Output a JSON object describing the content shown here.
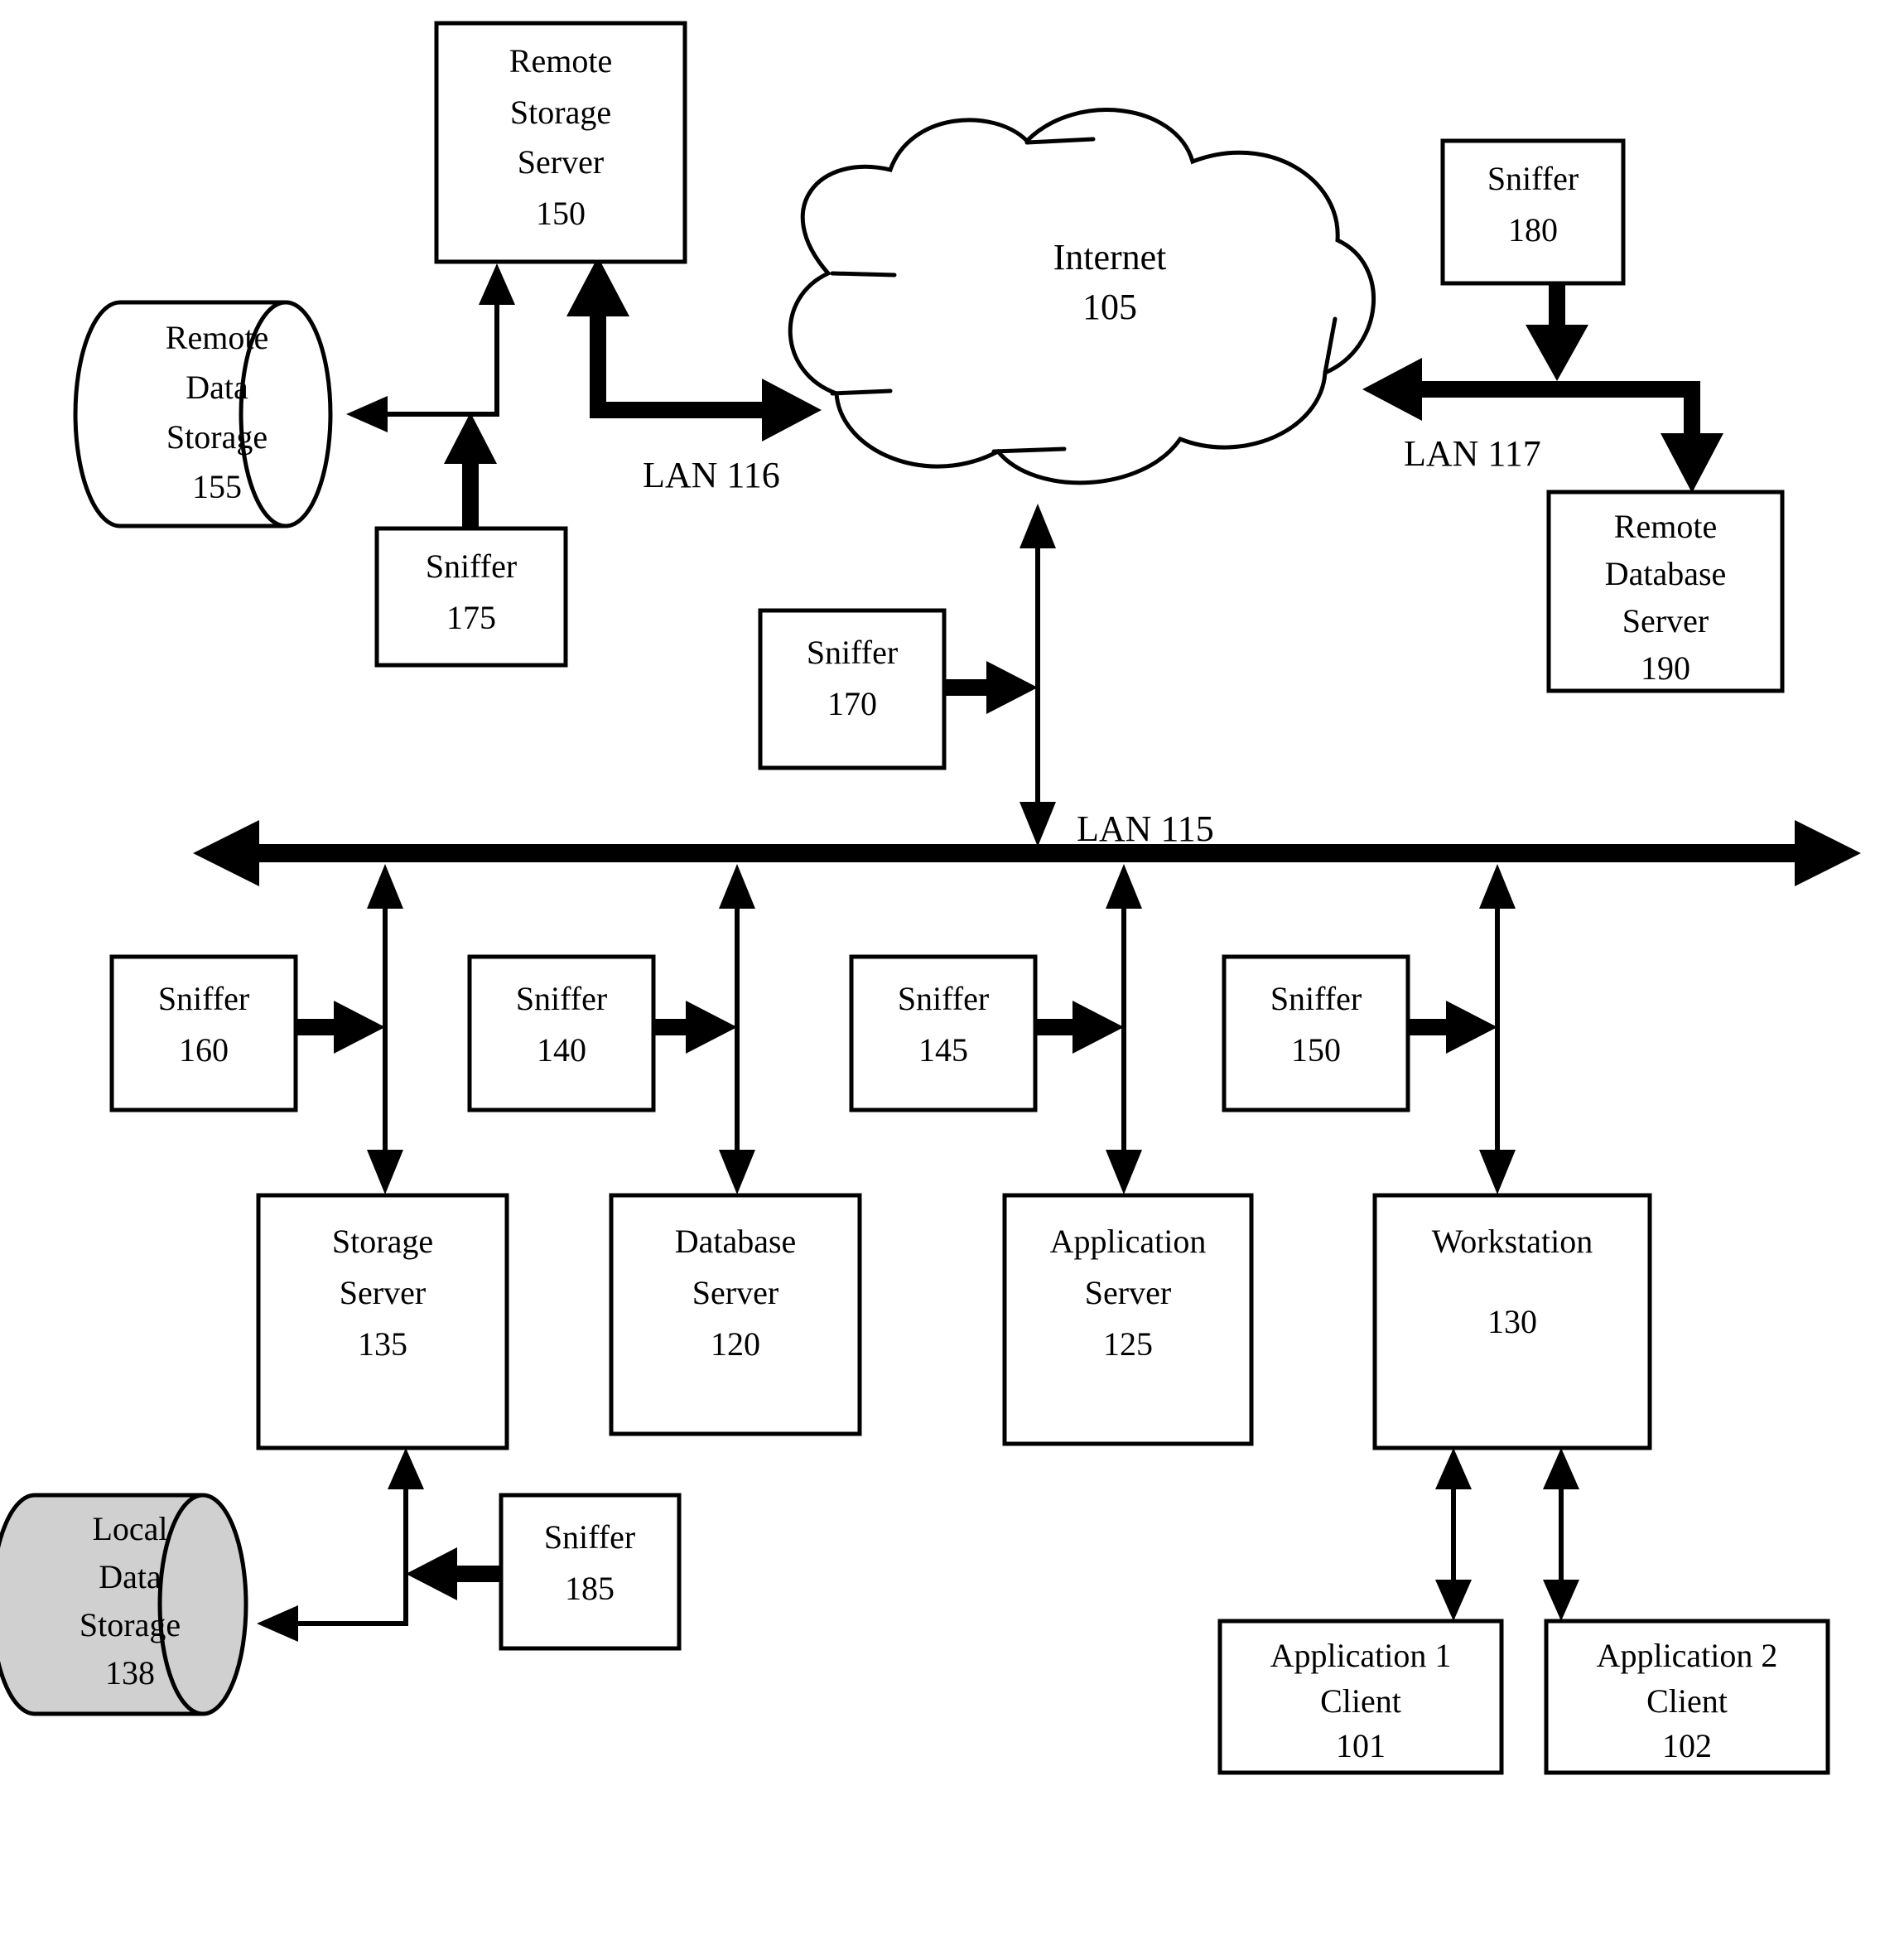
{
  "diagram": {
    "title": "Network monitoring architecture with sniffers",
    "nodes": {
      "remote_storage_server": {
        "line1": "Remote",
        "line2": "Storage",
        "line3": "Server",
        "ref": "150"
      },
      "remote_data_storage": {
        "line1": "Remote",
        "line2": "Data",
        "line3": "Storage",
        "ref": "155"
      },
      "sniffer_175": {
        "line1": "Sniffer",
        "ref": "175"
      },
      "internet": {
        "line1": "Internet",
        "ref": "105"
      },
      "sniffer_180": {
        "line1": "Sniffer",
        "ref": "180"
      },
      "remote_database_server": {
        "line1": "Remote",
        "line2": "Database",
        "line3": "Server",
        "ref": "190"
      },
      "sniffer_170": {
        "line1": "Sniffer",
        "ref": "170"
      },
      "sniffer_160": {
        "line1": "Sniffer",
        "ref": "160"
      },
      "sniffer_140": {
        "line1": "Sniffer",
        "ref": "140"
      },
      "sniffer_145": {
        "line1": "Sniffer",
        "ref": "145"
      },
      "sniffer_150": {
        "line1": "Sniffer",
        "ref": "150"
      },
      "storage_server": {
        "line1": "Storage",
        "line2": "Server",
        "ref": "135"
      },
      "database_server": {
        "line1": "Database",
        "line2": "Server",
        "ref": "120"
      },
      "application_server": {
        "line1": "Application",
        "line2": "Server",
        "ref": "125"
      },
      "workstation": {
        "line1": "Workstation",
        "ref": "130"
      },
      "local_data_storage": {
        "line1": "Local",
        "line2": "Data",
        "line3": "Storage",
        "ref": "138"
      },
      "sniffer_185": {
        "line1": "Sniffer",
        "ref": "185"
      },
      "application_1_client": {
        "line1": "Application 1",
        "line2": "Client",
        "ref": "101"
      },
      "application_2_client": {
        "line1": "Application 2",
        "line2": "Client",
        "ref": "102"
      }
    },
    "links": {
      "lan_115": "LAN 115",
      "lan_116": "LAN 116",
      "lan_117": "LAN 117"
    },
    "colors": {
      "stroke": "#000000",
      "fill": "#ffffff",
      "shaded_fill": "#d0d0d0"
    }
  }
}
